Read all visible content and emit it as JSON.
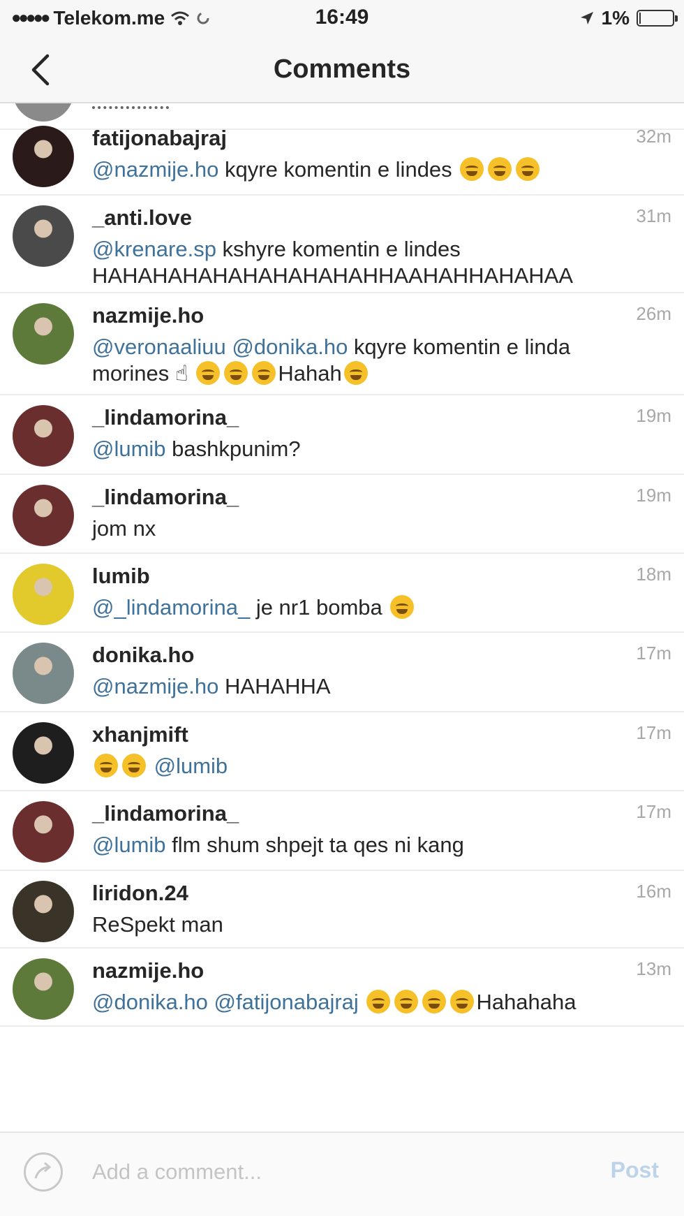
{
  "status_bar": {
    "carrier": "Telekom.me",
    "time": "16:49",
    "battery_percent_text": "1%",
    "battery_level": 0.01
  },
  "nav": {
    "title": "Comments"
  },
  "comments": [
    {
      "username": "fatijonabajraj",
      "time": "32m",
      "avatar_color": "#2b1a1a",
      "parts": [
        {
          "t": "mention",
          "v": "@nazmije.ho"
        },
        {
          "t": "text",
          "v": "  kqyre komentin e lindes "
        },
        {
          "t": "emoji",
          "v": "joy"
        },
        {
          "t": "emoji",
          "v": "joy"
        },
        {
          "t": "emoji",
          "v": "joy"
        }
      ]
    },
    {
      "username": "_anti.love",
      "time": "31m",
      "avatar_color": "#4a4a4a",
      "parts": [
        {
          "t": "mention",
          "v": "@krenare.sp"
        },
        {
          "t": "text",
          "v": " kshyre komentin e lindes HAHAHAHAHAHAHAHAHAHHAAHAHHAHAHAA"
        }
      ]
    },
    {
      "username": "nazmije.ho",
      "time": "26m",
      "avatar_color": "#5d7a3a",
      "parts": [
        {
          "t": "mention",
          "v": "@veronaaliuu"
        },
        {
          "t": "text",
          "v": "  "
        },
        {
          "t": "mention",
          "v": "@donika.ho"
        },
        {
          "t": "text",
          "v": " kqyre komentin e linda morines ☝ "
        },
        {
          "t": "emoji",
          "v": "joy"
        },
        {
          "t": "emoji",
          "v": "joy"
        },
        {
          "t": "emoji",
          "v": "joy"
        },
        {
          "t": "text",
          "v": "Hahah"
        },
        {
          "t": "emoji",
          "v": "joy"
        }
      ]
    },
    {
      "username": "_lindamorina_",
      "time": "19m",
      "avatar_color": "#6b2e2e",
      "parts": [
        {
          "t": "mention",
          "v": "@lumib"
        },
        {
          "t": "text",
          "v": " bashkpunim?"
        }
      ]
    },
    {
      "username": "_lindamorina_",
      "time": "19m",
      "avatar_color": "#6b2e2e",
      "parts": [
        {
          "t": "text",
          "v": "jom nx"
        }
      ]
    },
    {
      "username": "lumib",
      "time": "18m",
      "avatar_color": "#e2c92c",
      "parts": [
        {
          "t": "mention",
          "v": "@_lindamorina_"
        },
        {
          "t": "text",
          "v": " je nr1 bomba "
        },
        {
          "t": "emoji",
          "v": "joy"
        }
      ]
    },
    {
      "username": "donika.ho",
      "time": "17m",
      "avatar_color": "#7a8a8a",
      "parts": [
        {
          "t": "mention",
          "v": "@nazmije.ho"
        },
        {
          "t": "text",
          "v": " HAHAHHA"
        }
      ]
    },
    {
      "username": "xhanjmift",
      "time": "17m",
      "avatar_color": "#1e1e1e",
      "parts": [
        {
          "t": "emoji",
          "v": "joy"
        },
        {
          "t": "emoji",
          "v": "joy"
        },
        {
          "t": "text",
          "v": " "
        },
        {
          "t": "mention",
          "v": "@lumib"
        }
      ]
    },
    {
      "username": "_lindamorina_",
      "time": "17m",
      "avatar_color": "#6b2e2e",
      "parts": [
        {
          "t": "mention",
          "v": "@lumib"
        },
        {
          "t": "text",
          "v": " flm shum shpejt ta qes ni kang"
        }
      ]
    },
    {
      "username": "liridon.24",
      "time": "16m",
      "avatar_color": "#3a3327",
      "parts": [
        {
          "t": "text",
          "v": "ReSpekt man"
        }
      ]
    },
    {
      "username": "nazmije.ho",
      "time": "13m",
      "avatar_color": "#5d7a3a",
      "parts": [
        {
          "t": "mention",
          "v": "@donika.ho"
        },
        {
          "t": "text",
          "v": "  "
        },
        {
          "t": "mention",
          "v": "@fatijonabajraj"
        },
        {
          "t": "text",
          "v": " "
        },
        {
          "t": "emoji",
          "v": "joy"
        },
        {
          "t": "emoji",
          "v": "joy"
        },
        {
          "t": "emoji",
          "v": "joy"
        },
        {
          "t": "emoji",
          "v": "joy"
        },
        {
          "t": "text",
          "v": "Hahahaha"
        }
      ]
    }
  ],
  "composer": {
    "placeholder": "Add a comment...",
    "value": "",
    "post_label": "Post"
  },
  "colors": {
    "mention": "#3f729b",
    "timestamp": "#a8a8a8",
    "post_disabled": "#bcd3ea"
  }
}
